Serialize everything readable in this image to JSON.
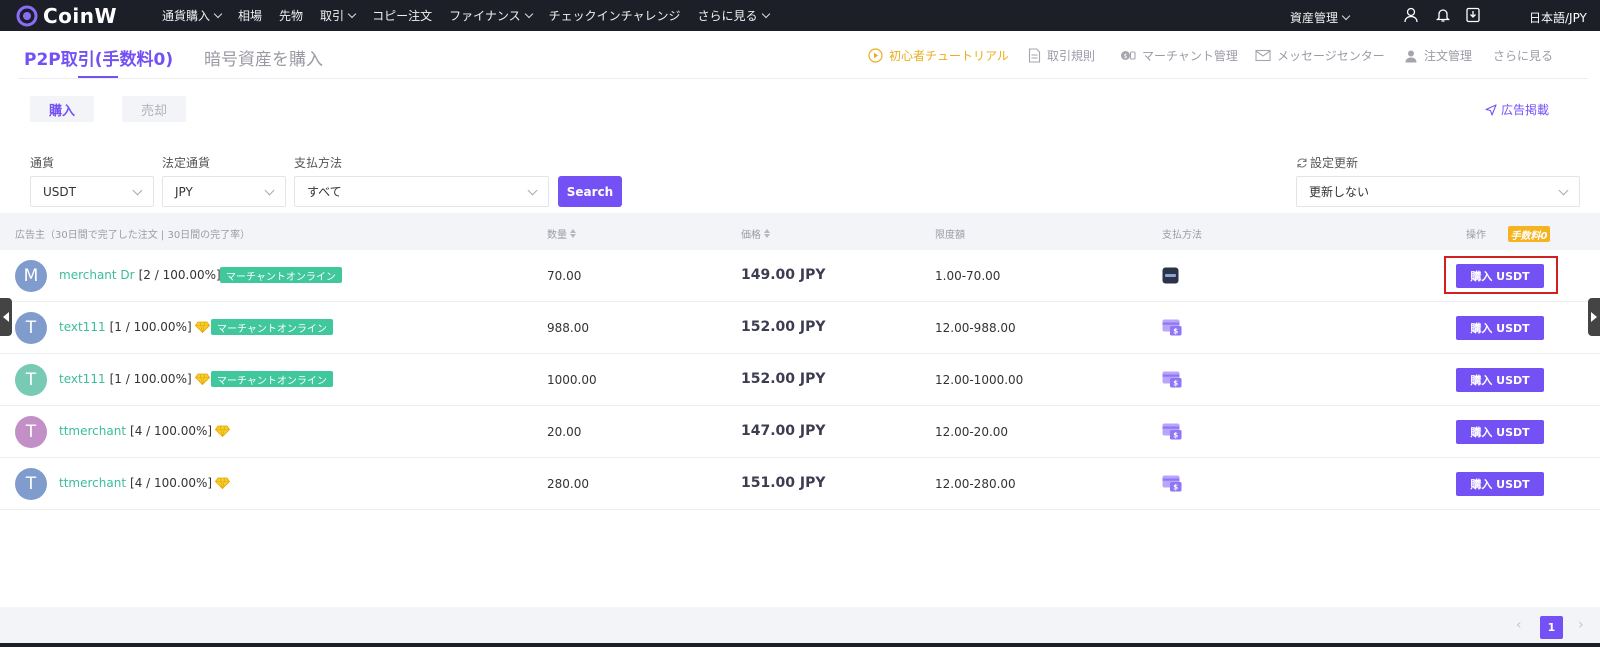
{
  "brand": {
    "name": "CoinW"
  },
  "nav": {
    "items": [
      "通貨購入",
      "相場",
      "先物",
      "取引",
      "コピー注文",
      "ファイナンス",
      "チェックインチャレンジ",
      "さらに見る"
    ],
    "assets": "資産管理",
    "language": "日本語/JPY"
  },
  "title_bar": {
    "tab_p2p": "P2P取引(手数料0)",
    "tab_buy_crypto": "暗号資産を購入",
    "links": {
      "tutorial": "初心者チュートリアル",
      "rules": "取引規則",
      "merchant": "マーチャント管理",
      "messages": "メッセージセンター",
      "orders": "注文管理",
      "more": "さらに見る"
    }
  },
  "trade_toggle": {
    "buy": "購入",
    "sell": "売却"
  },
  "post_ad": "広告掲載",
  "filters": {
    "currency_label": "通貨",
    "currency_value": "USDT",
    "fiat_label": "法定通貨",
    "fiat_value": "JPY",
    "payment_label": "支払方法",
    "payment_value": "すべて",
    "search": "Search",
    "refresh_label": "設定更新",
    "refresh_value": "更新しない"
  },
  "table": {
    "headers": {
      "advertiser": "広告主（30日間で完了した注文 | 30日間の完了率）",
      "quantity": "数量",
      "price": "価格",
      "limit": "限度額",
      "payment": "支払方法",
      "action": "操作"
    },
    "fee_badge": "手数料0",
    "online_label": "マーチャントオンライン",
    "buy_label": "購入 USDT",
    "rows": [
      {
        "initial": "M",
        "avatar_color": "#7f9ccc",
        "name": "merchant Dr",
        "stats": "[2 / 100.00%]",
        "gem": false,
        "online": true,
        "quantity": "70.00",
        "price": "149.00 JPY",
        "limit": "1.00-70.00",
        "payment_icon": "bank-card-dark-icon",
        "highlight": true
      },
      {
        "initial": "T",
        "avatar_color": "#7f9ccc",
        "name": "text111",
        "stats": "[1 / 100.00%]",
        "gem": true,
        "online": true,
        "quantity": "988.00",
        "price": "152.00 JPY",
        "limit": "12.00-988.00",
        "payment_icon": "cash-card-icon",
        "highlight": false
      },
      {
        "initial": "T",
        "avatar_color": "#78cab4",
        "name": "text111",
        "stats": "[1 / 100.00%]",
        "gem": true,
        "online": true,
        "quantity": "1000.00",
        "price": "152.00 JPY",
        "limit": "12.00-1000.00",
        "payment_icon": "cash-card-icon",
        "highlight": false
      },
      {
        "initial": "T",
        "avatar_color": "#c28fc6",
        "name": "ttmerchant",
        "stats": "[4 / 100.00%]",
        "gem": true,
        "online": false,
        "quantity": "20.00",
        "price": "147.00 JPY",
        "limit": "12.00-20.00",
        "payment_icon": "cash-card-icon",
        "highlight": false
      },
      {
        "initial": "T",
        "avatar_color": "#7f9ccc",
        "name": "ttmerchant",
        "stats": "[4 / 100.00%]",
        "gem": true,
        "online": false,
        "quantity": "280.00",
        "price": "151.00 JPY",
        "limit": "12.00-280.00",
        "payment_icon": "cash-card-icon",
        "highlight": false
      }
    ]
  },
  "pagination": {
    "prev": "‹",
    "current": "1",
    "next": "›"
  },
  "colors": {
    "accent": "#7451f5",
    "online_green": "#41c79c",
    "gold": "#e9ae1a",
    "highlight_red": "#d12020"
  }
}
